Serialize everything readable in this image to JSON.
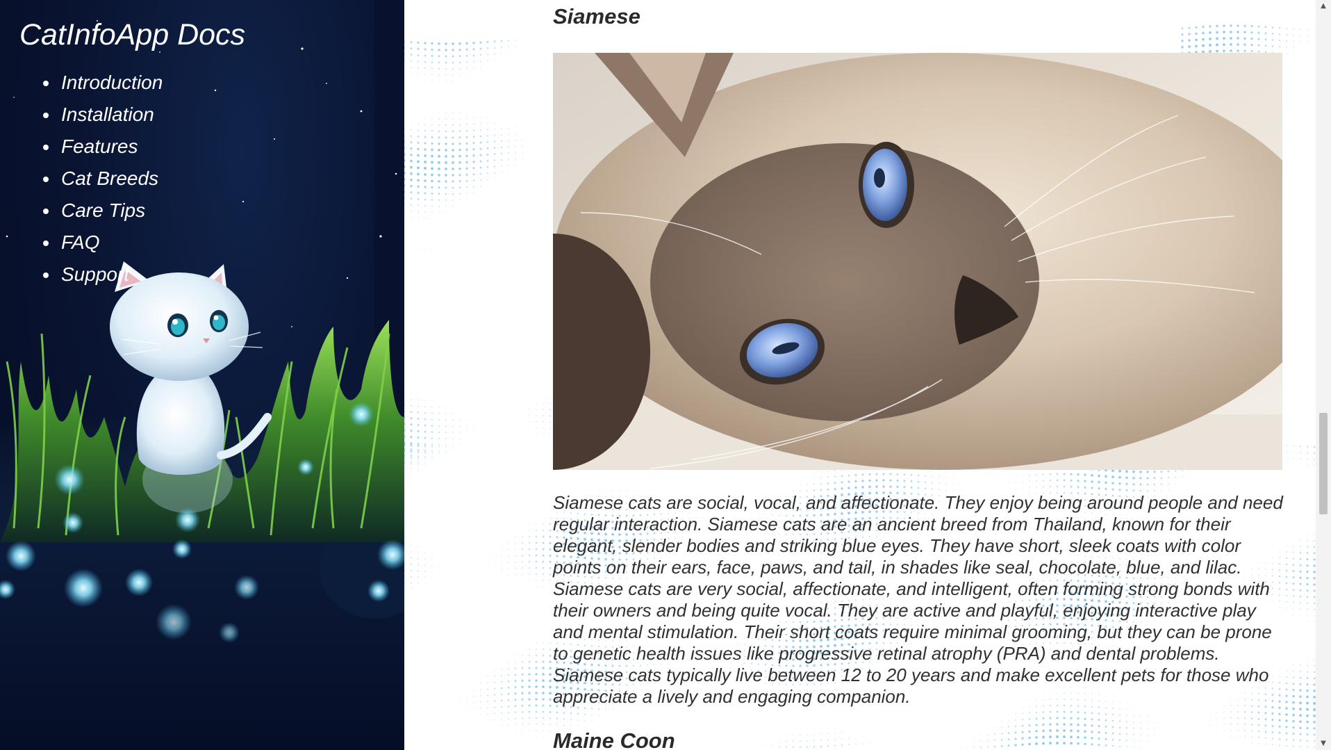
{
  "sidebar": {
    "title": "CatInfoApp Docs",
    "nav": [
      {
        "label": "Introduction"
      },
      {
        "label": "Installation"
      },
      {
        "label": "Features"
      },
      {
        "label": "Cat Breeds"
      },
      {
        "label": "Care Tips"
      },
      {
        "label": "FAQ"
      },
      {
        "label": "Support"
      }
    ]
  },
  "main": {
    "sections": [
      {
        "heading": "Siamese",
        "description": "Siamese cats are social, vocal, and affectionate. They enjoy being around people and need regular interaction. Siamese cats are an ancient breed from Thailand, known for their elegant, slender bodies and striking blue eyes. They have short, sleek coats with color points on their ears, face, paws, and tail, in shades like seal, chocolate, blue, and lilac. Siamese cats are very social, affectionate, and intelligent, often forming strong bonds with their owners and being quite vocal. They are active and playful, enjoying interactive play and mental stimulation. Their short coats require minimal grooming, but they can be prone to genetic health issues like progressive retinal atrophy (PRA) and dental problems. Siamese cats typically live between 12 to 20 years and make excellent pets for those who appreciate a lively and engaging companion."
      },
      {
        "heading": "Maine Coon"
      }
    ]
  },
  "colors": {
    "sidebar_bg": "#0a1533",
    "grass": "#4f9a2a",
    "glow": "#8fe6ff",
    "dot_pattern": "#4aa8e6",
    "text": "#303030"
  },
  "icons": {
    "scroll_up": "triangle-up",
    "scroll_down": "triangle-down"
  }
}
